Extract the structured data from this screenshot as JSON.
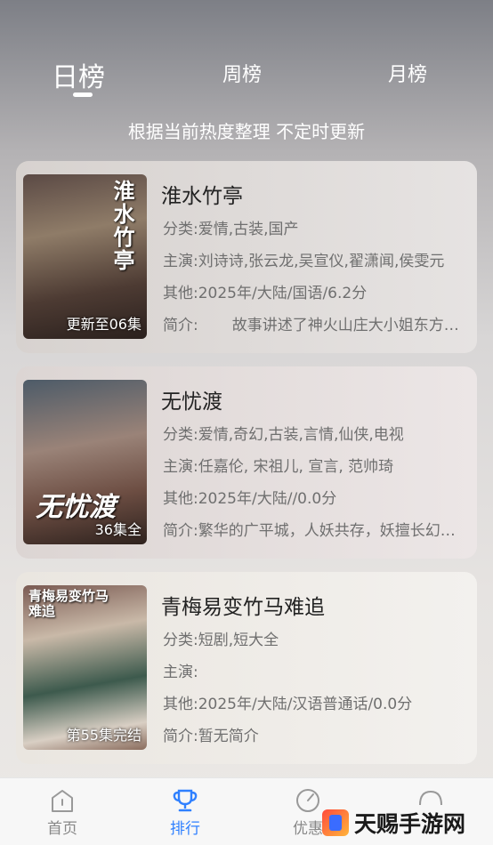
{
  "tabs": [
    {
      "label": "日榜",
      "active": true
    },
    {
      "label": "周榜",
      "active": false
    },
    {
      "label": "月榜",
      "active": false
    }
  ],
  "subtitle": "根据当前热度整理 不定时更新",
  "items": [
    {
      "title": "淮水竹亭",
      "poster_title": "淮水竹亭",
      "badge": "更新至06集",
      "category_label": "分类:",
      "category": "爱情,古装,国产",
      "cast_label": "主演:",
      "cast": "刘诗诗,张云龙,吴宣仪,翟潇闻,侯雯元",
      "other_label": "其他:",
      "other": "2025年/大陆/国语/6.2分",
      "intro_label": "简介:",
      "intro": "故事讲述了神火山庄大小姐东方淮竹"
    },
    {
      "title": "无忧渡",
      "poster_title": "无忧渡",
      "badge": "36集全",
      "category_label": "分类:",
      "category": "爱情,奇幻,古装,言情,仙侠,电视",
      "cast_label": "主演:",
      "cast": "任嘉伦, 宋祖儿, 宣言, 范帅琦",
      "other_label": "其他:",
      "other": "2025年/大陆//0.0分",
      "intro_label": "简介:",
      "intro": "繁华的广平城，人妖共存，妖擅长幻化人形"
    },
    {
      "title": "青梅易变竹马难追",
      "poster_title": "青梅易变竹马难追",
      "badge": "第55集完结",
      "category_label": "分类:",
      "category": "短剧,短大全",
      "cast_label": "主演:",
      "cast": "",
      "other_label": "其他:",
      "other": "2025年/大陆/汉语普通话/0.0分",
      "intro_label": "简介:",
      "intro": "暂无简介"
    }
  ],
  "bottom_nav": [
    {
      "label": "首页",
      "icon": "home-icon"
    },
    {
      "label": "排行",
      "icon": "trophy-icon",
      "active": true
    },
    {
      "label": "优惠",
      "icon": "gauge-icon"
    },
    {
      "label": "",
      "icon": "profile-icon"
    }
  ],
  "watermark": "天赐手游网",
  "colors": {
    "accent": "#2f80ff"
  }
}
